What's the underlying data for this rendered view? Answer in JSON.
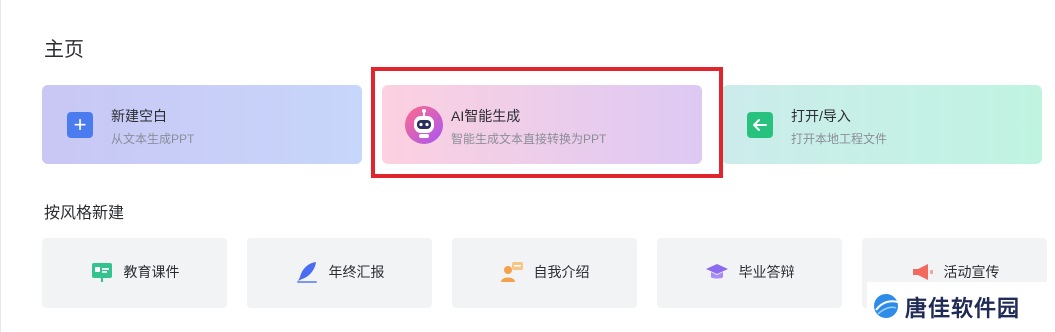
{
  "page": {
    "title": "主页",
    "section_title": "按风格新建"
  },
  "cards": {
    "new": {
      "label": "新建空白",
      "subtitle": "从文本生成PPT",
      "icon": "plus-icon",
      "color": "#4a7cf0"
    },
    "ai": {
      "label": "AI智能生成",
      "subtitle": "智能生成文本直接转换为PPT",
      "icon": "robot-icon"
    },
    "open": {
      "label": "打开/导入",
      "subtitle": "打开本地工程文件",
      "icon": "import-file-icon",
      "color": "#27c37e"
    }
  },
  "styles": [
    {
      "label": "教育课件",
      "icon": "presentation-board-icon"
    },
    {
      "label": "年终汇报",
      "icon": "feather-pen-icon"
    },
    {
      "label": "自我介绍",
      "icon": "person-speech-icon"
    },
    {
      "label": "毕业答辩",
      "icon": "graduation-cap-icon"
    },
    {
      "label": "活动宣传",
      "icon": "megaphone-icon"
    }
  ],
  "watermark": {
    "text": "唐佳软件园"
  },
  "colors": {
    "highlight": "#e0262c",
    "button_bg": "#f2f3f5"
  }
}
